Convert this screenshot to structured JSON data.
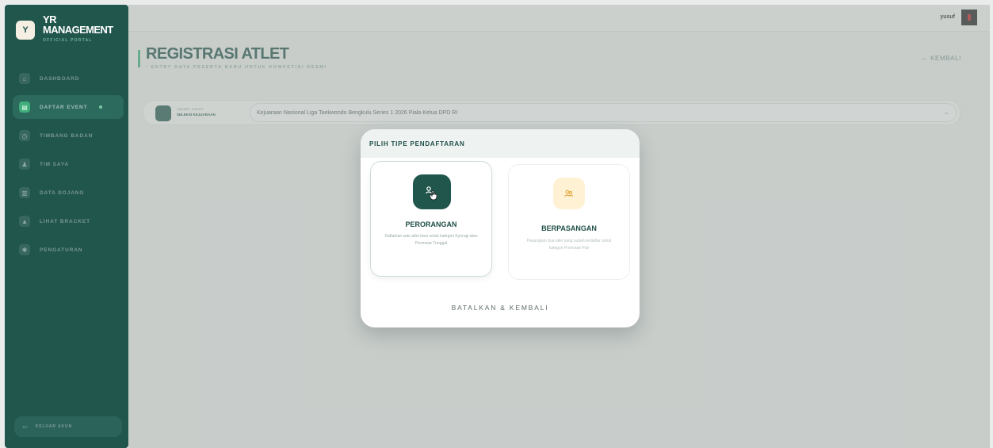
{
  "brand": {
    "logo_glyph": "Y",
    "line1": "YR",
    "line2": "MANAGEMENT",
    "tagline": "OFFICIAL PORTAL"
  },
  "sidebar": {
    "items": [
      {
        "label": "DASHBOARD",
        "icon": "home-icon",
        "glyph": "⌂",
        "active": false
      },
      {
        "label": "DAFTAR EVENT",
        "icon": "calendar-icon",
        "glyph": "▤",
        "active": true
      },
      {
        "label": "TIMBANG BADAN",
        "icon": "scale-icon",
        "glyph": "◷",
        "active": false
      },
      {
        "label": "TIM SAYA",
        "icon": "team-icon",
        "glyph": "♟",
        "active": false
      },
      {
        "label": "DATA DOJANG",
        "icon": "building-icon",
        "glyph": "▥",
        "active": false
      },
      {
        "label": "LIHAT BRACKET",
        "icon": "bracket-icon",
        "glyph": "▲",
        "active": false
      },
      {
        "label": "PENGATURAN",
        "icon": "settings-icon",
        "glyph": "✱",
        "active": false
      }
    ],
    "logout": {
      "label": "KELUAR AKUN",
      "glyph": "⇦"
    }
  },
  "header": {
    "username": "yusuf"
  },
  "page": {
    "title": "REGISTRASI ATLET",
    "subtitle": "• ENTRY DATA PESERTA BARU UNTUK KOMPETISI RESMI",
    "back_label": "← KEMBALI"
  },
  "event": {
    "label_top": "TARGET EVENT",
    "label": "SELEKSI KEJUARAAN",
    "selected": "Kejuaraan Nasional Liga Taekwondo Bengkulu Series 1 2026 Piala Ketua DPD RI",
    "chevron": "⌄"
  },
  "modal": {
    "title": "PILIH TIPE PENDAFTARAN",
    "options": [
      {
        "title": "PERORANGAN",
        "description": "Daftarkan satu atlet baru untuk kategori Kyorugi atau Poomsae Tunggal"
      },
      {
        "title": "BERPASANGAN",
        "description": "Pasangkan dua atlet yang sudah terdaftar untuk kategori Poomsae Pair"
      }
    ],
    "cancel_label": "BATALKAN & KEMBALI"
  },
  "colors": {
    "primary": "#21564d",
    "accent": "#3fae7a",
    "pair_bg": "#fff1d3",
    "pair_icon": "#e0a53a"
  }
}
